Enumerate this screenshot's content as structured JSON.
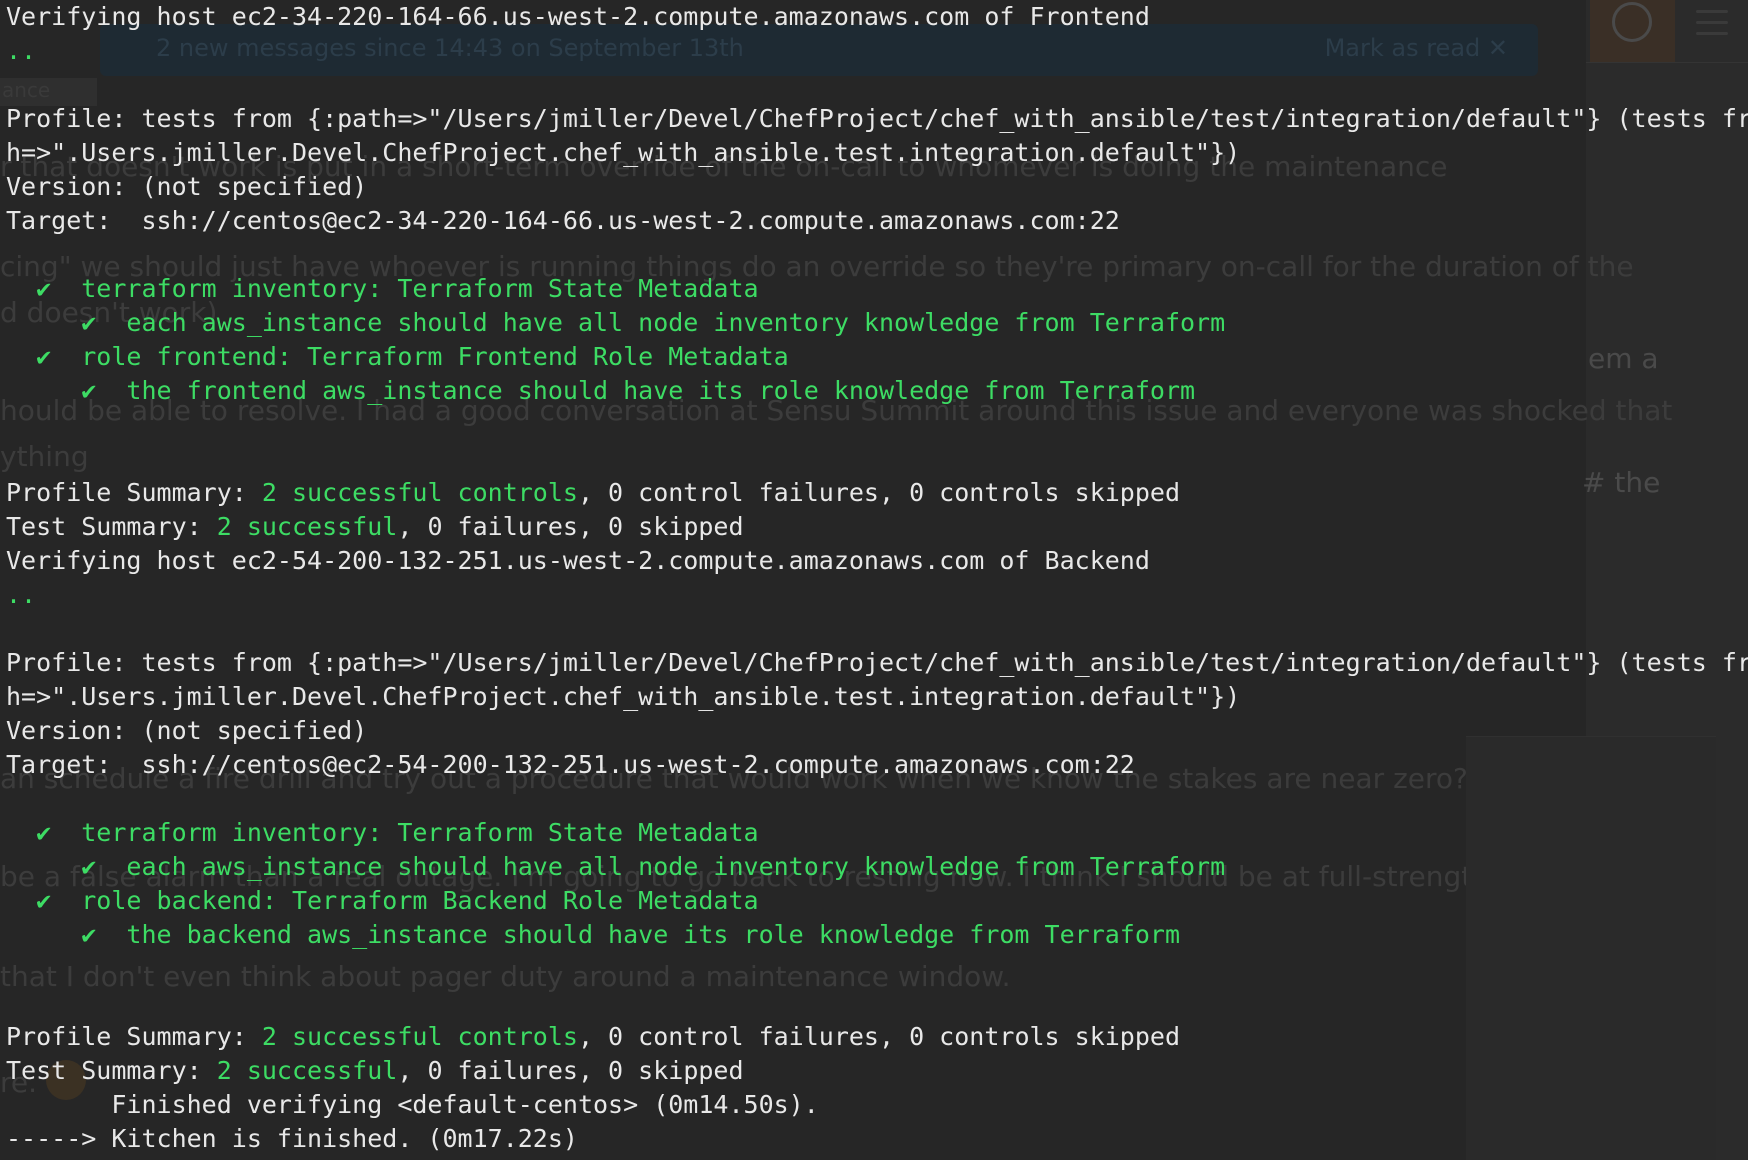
{
  "background_app": {
    "banner": {
      "text": "2 new messages since 14:43 on September 13th",
      "action": "Mark as read ✕"
    },
    "tab_label": "ance",
    "chat_lines": [
      "r that doesn't work is put in a short-term override of the on-call to whomever is doing the maintenance",
      "cing\" we should just have whoever is running things do an override so they're primary on-call for the duration of the",
      "d doesn't work)",
      "hould be able to resolve. I had a good conversation at Sensu Summit around this issue and everyone was shocked that",
      "ything",
      "an schedule a fire drill and try out a procedure that would work when we know the stakes are near zero?",
      "be a false alarm than a real outage. I'm going to go back to resting now. I think I should be at full-strength tomorrow.",
      "that I don't even think about pager duty around a maintenance window.",
      "re."
    ],
    "right_fragments": [
      "em a",
      "# the"
    ]
  },
  "terminal": {
    "lines": [
      [
        {
          "t": "Verifying host ec2-34-220-164-66.us-west-2.compute.amazonaws.com of Frontend",
          "c": "w"
        }
      ],
      [
        {
          "t": "..",
          "c": "g"
        }
      ],
      [
        {
          "t": "",
          "c": "w"
        }
      ],
      [
        {
          "t": "Profile: tests from {:path=>\"/Users/jmiller/Devel/ChefProject/chef_with_ansible/test/integration/default\"} (tests from {:pat",
          "c": "w"
        }
      ],
      [
        {
          "t": "h=>\".Users.jmiller.Devel.ChefProject.chef_with_ansible.test.integration.default\"})",
          "c": "w"
        }
      ],
      [
        {
          "t": "Version: (not specified)",
          "c": "w"
        }
      ],
      [
        {
          "t": "Target:  ssh://centos@ec2-34-220-164-66.us-west-2.compute.amazonaws.com:22",
          "c": "w"
        }
      ],
      [
        {
          "t": "",
          "c": "w"
        }
      ],
      [
        {
          "t": "  ✔  terraform inventory: Terraform State Metadata",
          "c": "g"
        }
      ],
      [
        {
          "t": "     ✔  each aws_instance should have all node inventory knowledge from Terraform",
          "c": "g"
        }
      ],
      [
        {
          "t": "  ✔  role frontend: Terraform Frontend Role Metadata",
          "c": "g"
        }
      ],
      [
        {
          "t": "     ✔  the frontend aws_instance should have its role knowledge from Terraform",
          "c": "g"
        }
      ],
      [
        {
          "t": "",
          "c": "w"
        }
      ],
      [
        {
          "t": "",
          "c": "w"
        }
      ],
      [
        {
          "t": "Profile Summary: ",
          "c": "w"
        },
        {
          "t": "2 successful controls",
          "c": "g"
        },
        {
          "t": ", 0 control failures, 0 controls skipped",
          "c": "w"
        }
      ],
      [
        {
          "t": "Test Summary: ",
          "c": "w"
        },
        {
          "t": "2 successful",
          "c": "g"
        },
        {
          "t": ", 0 failures, 0 skipped",
          "c": "w"
        }
      ],
      [
        {
          "t": "Verifying host ec2-54-200-132-251.us-west-2.compute.amazonaws.com of Backend",
          "c": "w"
        }
      ],
      [
        {
          "t": "..",
          "c": "g"
        }
      ],
      [
        {
          "t": "",
          "c": "w"
        }
      ],
      [
        {
          "t": "Profile: tests from {:path=>\"/Users/jmiller/Devel/ChefProject/chef_with_ansible/test/integration/default\"} (tests from {:pat",
          "c": "w"
        }
      ],
      [
        {
          "t": "h=>\".Users.jmiller.Devel.ChefProject.chef_with_ansible.test.integration.default\"})",
          "c": "w"
        }
      ],
      [
        {
          "t": "Version: (not specified)",
          "c": "w"
        }
      ],
      [
        {
          "t": "Target:  ssh://centos@ec2-54-200-132-251.us-west-2.compute.amazonaws.com:22",
          "c": "w"
        }
      ],
      [
        {
          "t": "",
          "c": "w"
        }
      ],
      [
        {
          "t": "  ✔  terraform inventory: Terraform State Metadata",
          "c": "g"
        }
      ],
      [
        {
          "t": "     ✔  each aws_instance should have all node inventory knowledge from Terraform",
          "c": "g"
        }
      ],
      [
        {
          "t": "  ✔  role backend: Terraform Backend Role Metadata",
          "c": "g"
        }
      ],
      [
        {
          "t": "     ✔  the backend aws_instance should have its role knowledge from Terraform",
          "c": "g"
        }
      ],
      [
        {
          "t": "",
          "c": "w"
        }
      ],
      [
        {
          "t": "",
          "c": "w"
        }
      ],
      [
        {
          "t": "Profile Summary: ",
          "c": "w"
        },
        {
          "t": "2 successful controls",
          "c": "g"
        },
        {
          "t": ", 0 control failures, 0 controls skipped",
          "c": "w"
        }
      ],
      [
        {
          "t": "Test Summary: ",
          "c": "w"
        },
        {
          "t": "2 successful",
          "c": "g"
        },
        {
          "t": ", 0 failures, 0 skipped",
          "c": "w"
        }
      ],
      [
        {
          "t": "       Finished verifying <default-centos> (0m14.50s).",
          "c": "w"
        }
      ],
      [
        {
          "t": "-----> Kitchen is finished. (0m17.22s)",
          "c": "w"
        }
      ]
    ]
  }
}
